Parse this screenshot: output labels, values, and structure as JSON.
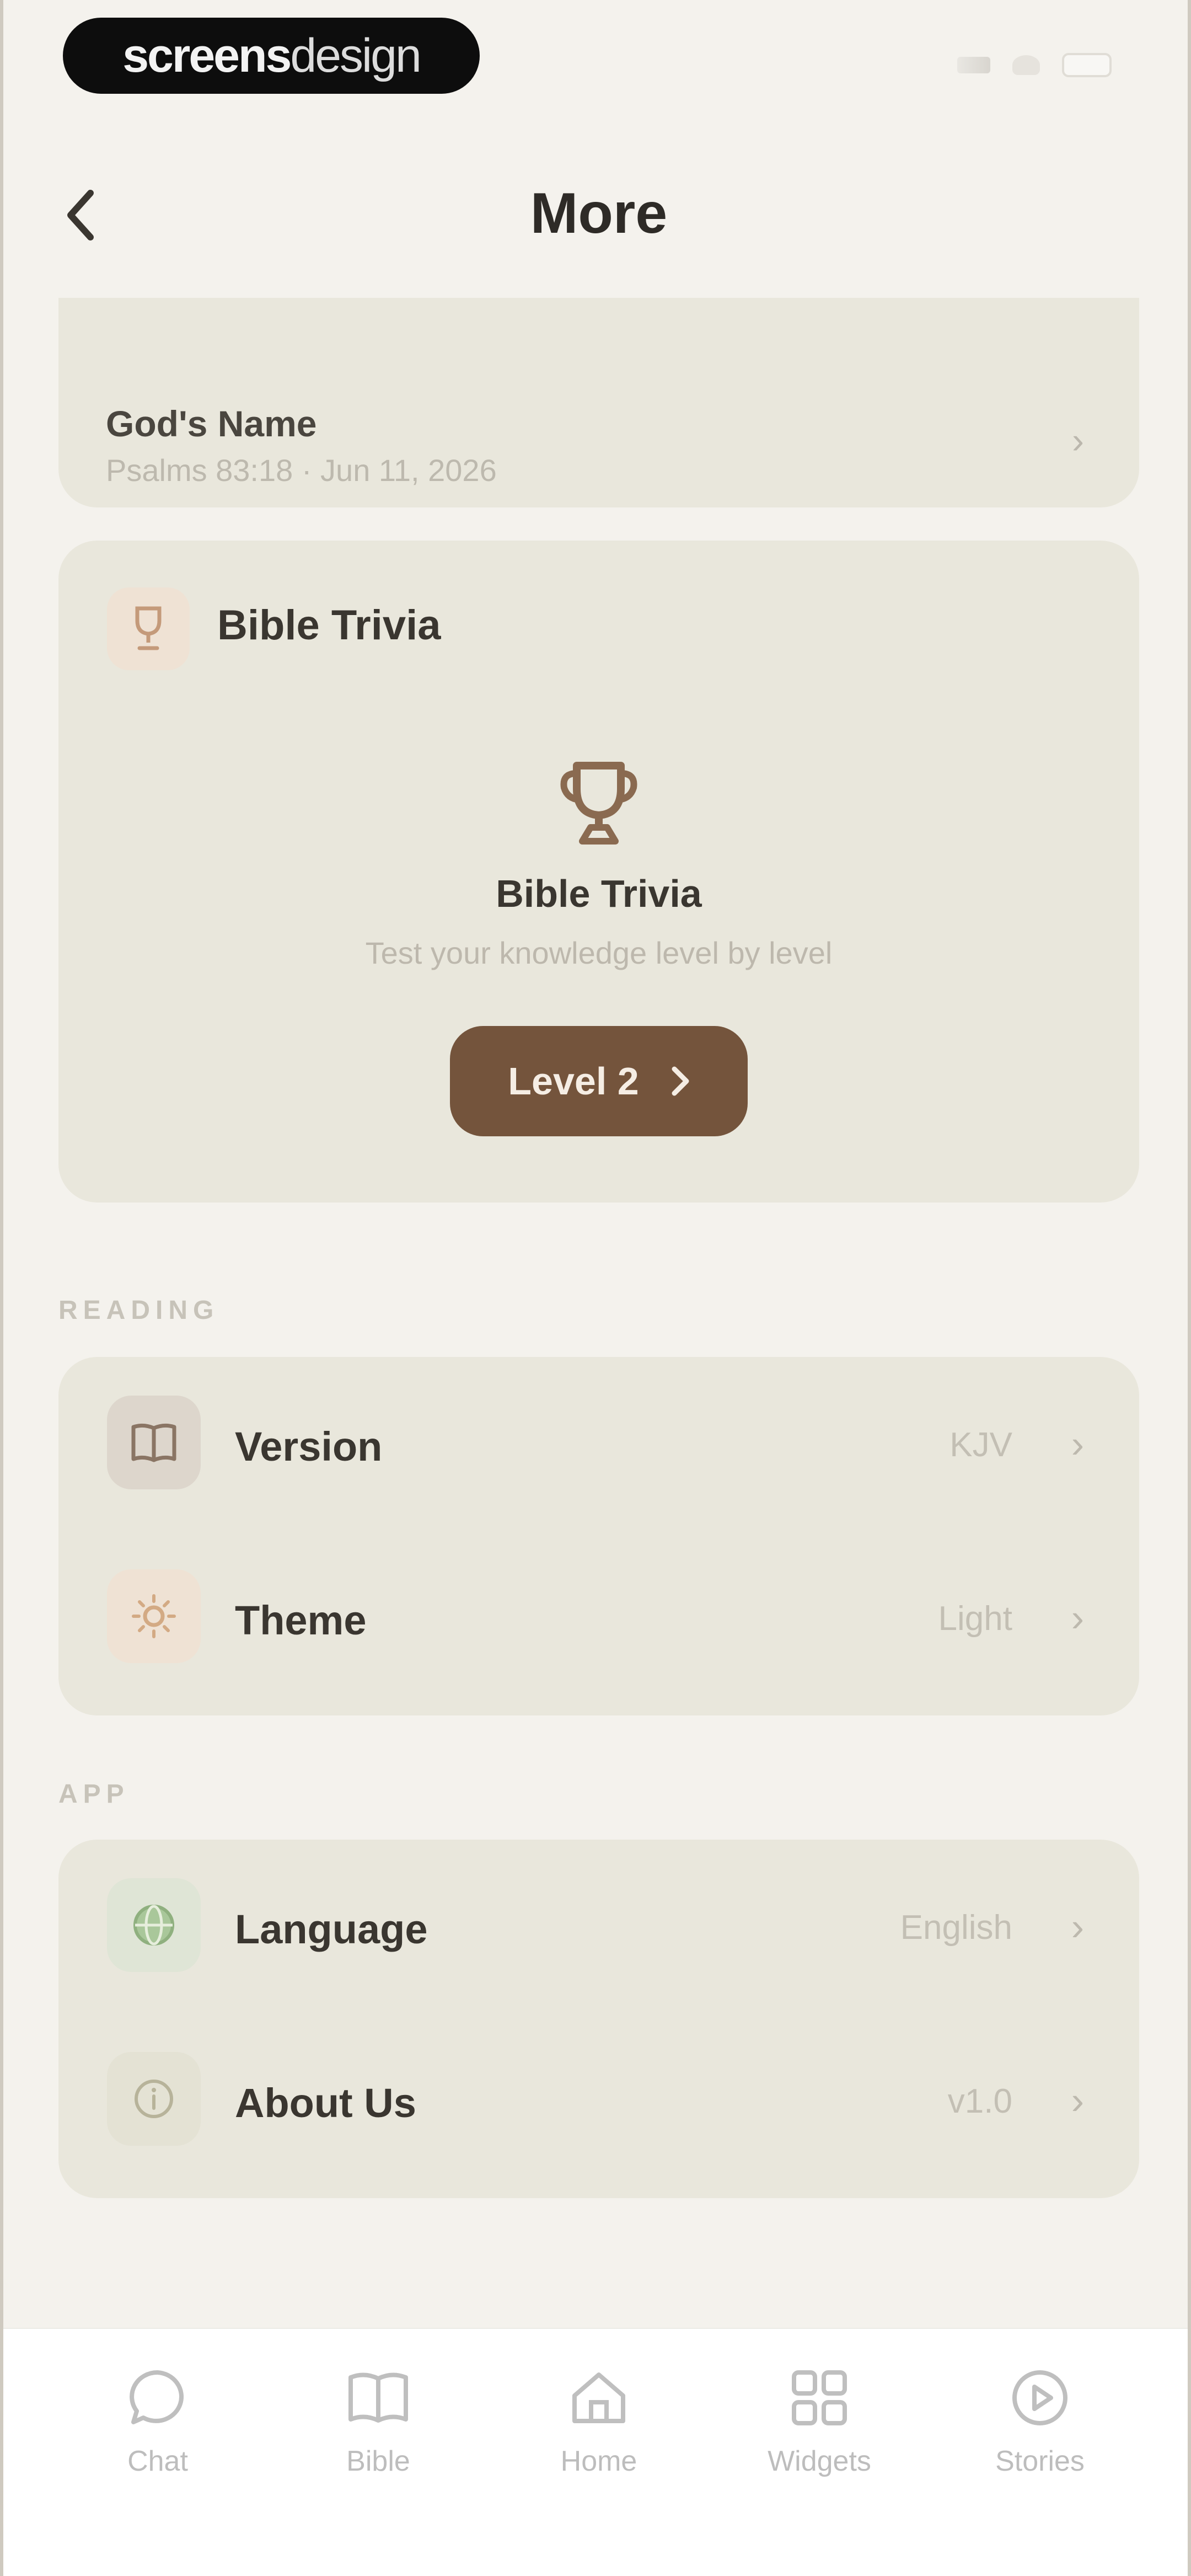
{
  "status_bar": {
    "brand_bold": "screens",
    "brand_light": "design"
  },
  "nav": {
    "title": "More",
    "back_icon": "chevron-left-icon"
  },
  "verse_card": {
    "title": "God's Name",
    "subtitle": "Psalms 83:18 · Jun 11, 2026"
  },
  "trivia": {
    "header_title": "Bible Trivia",
    "title": "Bible Trivia",
    "description": "Test your knowledge level by level",
    "button_label": "Level 2",
    "accent": "#74543c"
  },
  "reading": {
    "section_label": "READING",
    "rows": [
      {
        "label": "Version",
        "value": "KJV",
        "icon": "book-icon"
      },
      {
        "label": "Theme",
        "value": "Light",
        "icon": "sun-icon"
      }
    ]
  },
  "app": {
    "section_label": "APP",
    "rows": [
      {
        "label": "Language",
        "value": "English",
        "icon": "globe-icon"
      },
      {
        "label": "About Us",
        "value": "v1.0",
        "icon": "info-icon"
      }
    ]
  },
  "tabs": [
    {
      "label": "Chat",
      "icon": "chat-bubble-icon"
    },
    {
      "label": "Bible",
      "icon": "book-icon"
    },
    {
      "label": "Home",
      "icon": "home-icon"
    },
    {
      "label": "Widgets",
      "icon": "grid-icon"
    },
    {
      "label": "Stories",
      "icon": "play-circle-icon"
    }
  ]
}
